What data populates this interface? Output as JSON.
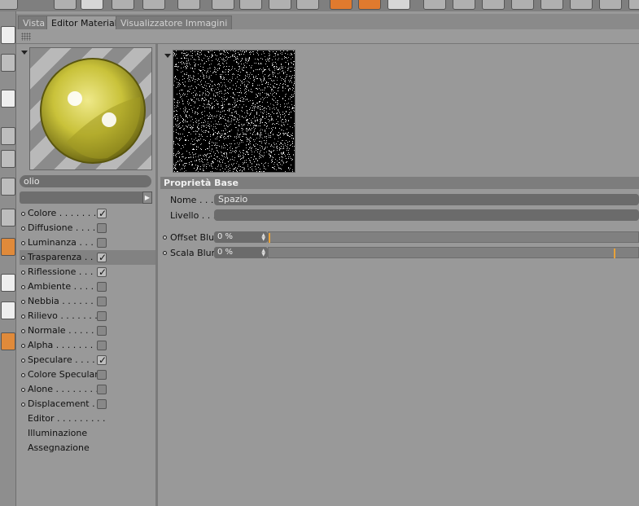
{
  "tabs": [
    "Vista",
    "Editor Materiale",
    "Visualizzatore Immagini"
  ],
  "active_tab": "Editor Materiale",
  "material": {
    "name": "olio"
  },
  "channels": [
    {
      "label": "Colore . . . . . . . . .",
      "checked": true,
      "selected": false
    },
    {
      "label": "Diffusione . . . . . .",
      "checked": false,
      "selected": false
    },
    {
      "label": "Luminanza . . . . .",
      "checked": false,
      "selected": false
    },
    {
      "label": "Trasparenza . . . .",
      "checked": true,
      "selected": true
    },
    {
      "label": "Riflessione . . . . .",
      "checked": true,
      "selected": false
    },
    {
      "label": "Ambiente . . . . . .",
      "checked": false,
      "selected": false
    },
    {
      "label": "Nebbia . . . . . . . .",
      "checked": false,
      "selected": false
    },
    {
      "label": "Rilievo . . . . . . . .",
      "checked": false,
      "selected": false
    },
    {
      "label": "Normale . . . . . . .",
      "checked": false,
      "selected": false
    },
    {
      "label": "Alpha . . . . . . . . .",
      "checked": false,
      "selected": false
    },
    {
      "label": "Speculare . . . . . .",
      "checked": true,
      "selected": false
    },
    {
      "label": "Colore Speculare",
      "checked": false,
      "selected": false
    },
    {
      "label": "Alone . . . . . . . . .",
      "checked": false,
      "selected": false
    },
    {
      "label": "Displacement . . .",
      "checked": false,
      "selected": false
    }
  ],
  "extra_items": [
    "Editor . . . . . . . . .",
    "Illuminazione",
    "Assegnazione"
  ],
  "properties": {
    "header": "Proprietà Base",
    "nome_label": "Nome . . .",
    "nome_value": "Spazio",
    "livello_label": "Livello . . .",
    "offset_blur_label": "Offset Blur",
    "offset_blur_value": "0 %",
    "scala_blur_label": "Scala Blur",
    "scala_blur_value": "0 %"
  },
  "colors": {
    "accent": "#e8a23a",
    "panel": "#999999",
    "field": "#6b6b6b"
  }
}
